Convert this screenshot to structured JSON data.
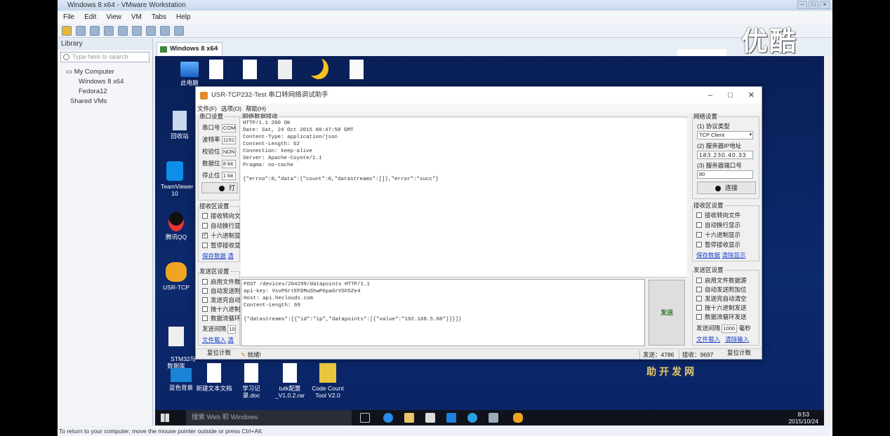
{
  "vmware": {
    "title": "Windows 8 x64 - VMware Workstation",
    "menu": [
      "File",
      "Edit",
      "View",
      "VM",
      "Tabs",
      "Help"
    ],
    "library": {
      "header": "Library",
      "search_placeholder": "Type here to search",
      "tree": [
        "My Computer",
        "Windows 8 x64",
        "Fedora12",
        "Shared VMs"
      ]
    },
    "tab_label": "Windows 8 x64",
    "tab_close": "×",
    "status_text": "To return to your computer, move the mouse pointer outside or press Ctrl+Alt."
  },
  "desktop": {
    "icons_left": [
      {
        "label": "此电脑",
        "icon": "computer-icon"
      },
      {
        "label": "回收站",
        "icon": "recycle-bin-icon"
      },
      {
        "label": "TeamViewer 10",
        "icon": "teamviewer-icon"
      },
      {
        "label": "腾讯QQ",
        "icon": "qq-icon"
      },
      {
        "label": "USR-TCP",
        "icon": "usr-tcp-icon"
      },
      {
        "label": "STM32与\n数据库",
        "icon": "document-icon"
      }
    ],
    "icons_bottom": [
      {
        "label": "蓝色背景",
        "icon": "folder-icon"
      },
      {
        "label": "新建文本文档",
        "icon": "text-file-icon"
      },
      {
        "label": "学习记录.doc",
        "icon": "doc-icon"
      },
      {
        "label": "tutk配置_V1.0.2.rar",
        "icon": "rar-icon"
      },
      {
        "label": "Code Count Tool V2.0",
        "icon": "code-count-icon"
      }
    ],
    "taskbar_search": "搜索 Web 和 Windows",
    "clock_time": "8:53",
    "clock_date": "2015/10/24"
  },
  "app": {
    "title": "USR-TCP232-Test 串口转网络调试助手",
    "menu": [
      "文件(F)",
      "选项(O)",
      "帮助(H)"
    ],
    "serial": {
      "legend": "串口设置",
      "rows": [
        {
          "label": "串口号",
          "value": "COM"
        },
        {
          "label": "波特率",
          "value": "1152"
        },
        {
          "label": "校验位",
          "value": "NON"
        },
        {
          "label": "数据位",
          "value": "8 bit"
        },
        {
          "label": "停止位",
          "value": "1 bit"
        }
      ],
      "open_button": "打"
    },
    "recv_left": {
      "legend": "接收区设置",
      "options": [
        {
          "label": "接收转向文",
          "checked": false
        },
        {
          "label": "自动换行显",
          "checked": false
        },
        {
          "label": "十六进制显",
          "checked": true
        },
        {
          "label": "暂停接收显",
          "checked": false
        }
      ],
      "links": [
        "保存数据",
        "清"
      ]
    },
    "send_left": {
      "legend": "发送区设置",
      "options": [
        {
          "label": "启用文件数",
          "checked": false
        },
        {
          "label": "自动发送附",
          "checked": false
        },
        {
          "label": "发送完自动",
          "checked": false
        },
        {
          "label": "按十六进制",
          "checked": false
        },
        {
          "label": "数据流循环",
          "checked": false
        }
      ],
      "interval_label": "发送间隔",
      "interval_value": "10",
      "links": [
        "文件载入",
        "清"
      ]
    },
    "data_legend": "网络数据接收",
    "received": "HTTP/1.1 200 OK\nDate: Sat, 24 Oct 2015 00:47:58 GMT\nContent-Type: application/json\nContent-Length: 62\nConnection: keep-alive\nServer: Apache-Coyote/1.1\nPragma: no-cache\n\n{\"errno\":0,\"data\":{\"count\":0,\"datastreams\":[]},\"error\":\"succ\"}",
    "send_text": "POST /devices/204299/datapoints HTTP/1.1\napi-key: VsvPGrtEFDMuShwP6paGrVSh5Ze4\nHost: api.heclouds.com\nContent-Length: 69\n\n{\"datastreams\":[{\"id\":\"ip\",\"datapoints\":[{\"value\":\"192.168.5.88\"}]}]}",
    "send_button": "发送",
    "network": {
      "legend": "网络设置",
      "protocol_label": "(1) 协议类型",
      "protocol_value": "TCP Client",
      "ip_label": "(2) 服务器IP地址",
      "ip_value": "183.230.40.33",
      "port_label": "(3) 服务器端口号",
      "port_value": "80",
      "connect_button": "连接"
    },
    "recv_right": {
      "legend": "接收区设置",
      "options": [
        "接收转向文件",
        "自动换行显示",
        "十六进制显示",
        "暂停接收显示"
      ],
      "links": [
        "保存数据",
        "清除显示"
      ]
    },
    "send_right": {
      "legend": "发送区设置",
      "options": [
        "启用文件数据源",
        "自动发送附加位",
        "发送完自动清空",
        "按十六进制发送",
        "数据流循环发送"
      ],
      "interval_label": "发送间隔",
      "interval_value": "1000",
      "interval_unit": "毫秒",
      "links": [
        "文件载入",
        "清除输入"
      ]
    },
    "statusbar": {
      "reset_count": "复位计数",
      "ready": "就绪!",
      "sent": "发送：4786",
      "received": "接收：9697",
      "reset_count_right": "复位计数"
    }
  },
  "watermarks": {
    "youku": "优酷",
    "site": "助开发网"
  }
}
